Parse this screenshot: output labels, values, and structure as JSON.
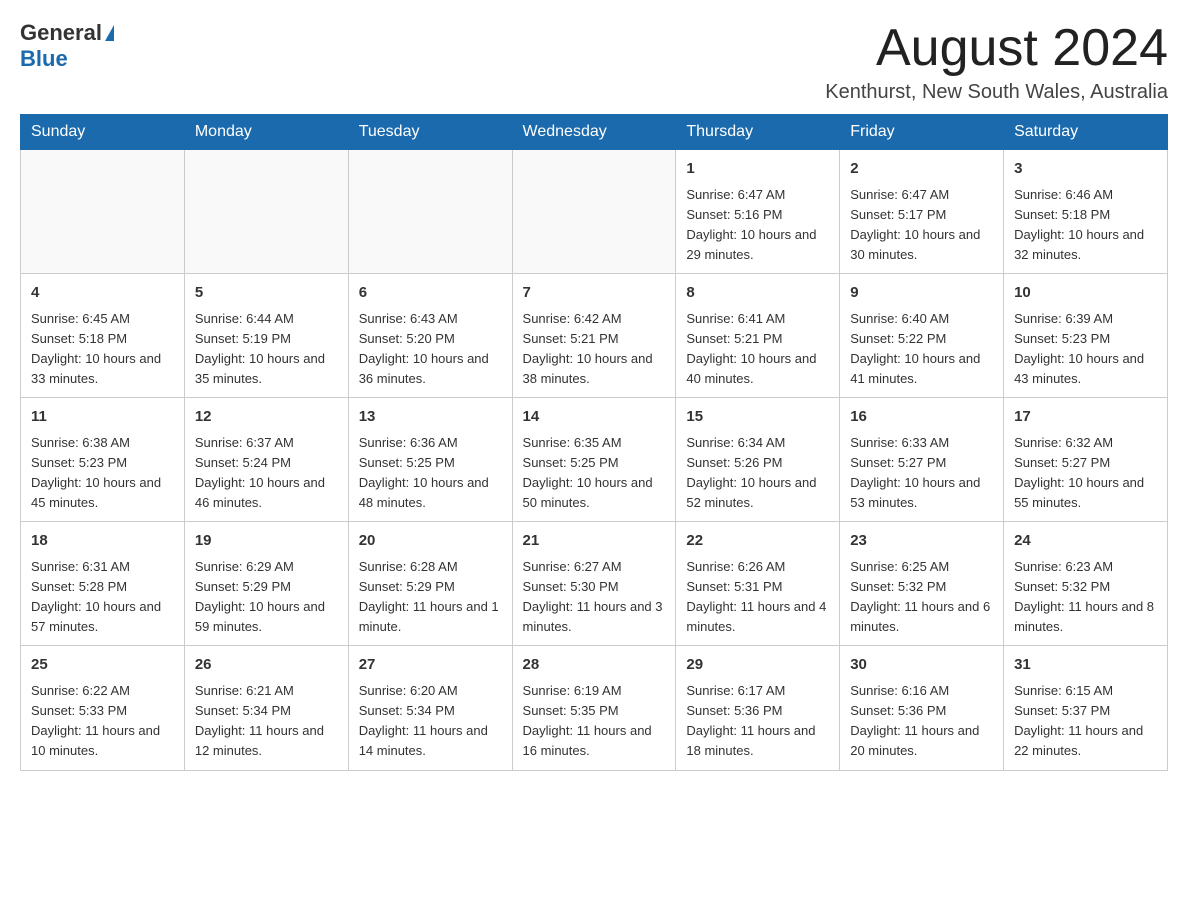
{
  "header": {
    "logo_general": "General",
    "logo_blue": "Blue",
    "month_title": "August 2024",
    "location": "Kenthurst, New South Wales, Australia"
  },
  "days_of_week": [
    "Sunday",
    "Monday",
    "Tuesday",
    "Wednesday",
    "Thursday",
    "Friday",
    "Saturday"
  ],
  "weeks": [
    [
      {
        "day": "",
        "info": ""
      },
      {
        "day": "",
        "info": ""
      },
      {
        "day": "",
        "info": ""
      },
      {
        "day": "",
        "info": ""
      },
      {
        "day": "1",
        "info": "Sunrise: 6:47 AM\nSunset: 5:16 PM\nDaylight: 10 hours and 29 minutes."
      },
      {
        "day": "2",
        "info": "Sunrise: 6:47 AM\nSunset: 5:17 PM\nDaylight: 10 hours and 30 minutes."
      },
      {
        "day": "3",
        "info": "Sunrise: 6:46 AM\nSunset: 5:18 PM\nDaylight: 10 hours and 32 minutes."
      }
    ],
    [
      {
        "day": "4",
        "info": "Sunrise: 6:45 AM\nSunset: 5:18 PM\nDaylight: 10 hours and 33 minutes."
      },
      {
        "day": "5",
        "info": "Sunrise: 6:44 AM\nSunset: 5:19 PM\nDaylight: 10 hours and 35 minutes."
      },
      {
        "day": "6",
        "info": "Sunrise: 6:43 AM\nSunset: 5:20 PM\nDaylight: 10 hours and 36 minutes."
      },
      {
        "day": "7",
        "info": "Sunrise: 6:42 AM\nSunset: 5:21 PM\nDaylight: 10 hours and 38 minutes."
      },
      {
        "day": "8",
        "info": "Sunrise: 6:41 AM\nSunset: 5:21 PM\nDaylight: 10 hours and 40 minutes."
      },
      {
        "day": "9",
        "info": "Sunrise: 6:40 AM\nSunset: 5:22 PM\nDaylight: 10 hours and 41 minutes."
      },
      {
        "day": "10",
        "info": "Sunrise: 6:39 AM\nSunset: 5:23 PM\nDaylight: 10 hours and 43 minutes."
      }
    ],
    [
      {
        "day": "11",
        "info": "Sunrise: 6:38 AM\nSunset: 5:23 PM\nDaylight: 10 hours and 45 minutes."
      },
      {
        "day": "12",
        "info": "Sunrise: 6:37 AM\nSunset: 5:24 PM\nDaylight: 10 hours and 46 minutes."
      },
      {
        "day": "13",
        "info": "Sunrise: 6:36 AM\nSunset: 5:25 PM\nDaylight: 10 hours and 48 minutes."
      },
      {
        "day": "14",
        "info": "Sunrise: 6:35 AM\nSunset: 5:25 PM\nDaylight: 10 hours and 50 minutes."
      },
      {
        "day": "15",
        "info": "Sunrise: 6:34 AM\nSunset: 5:26 PM\nDaylight: 10 hours and 52 minutes."
      },
      {
        "day": "16",
        "info": "Sunrise: 6:33 AM\nSunset: 5:27 PM\nDaylight: 10 hours and 53 minutes."
      },
      {
        "day": "17",
        "info": "Sunrise: 6:32 AM\nSunset: 5:27 PM\nDaylight: 10 hours and 55 minutes."
      }
    ],
    [
      {
        "day": "18",
        "info": "Sunrise: 6:31 AM\nSunset: 5:28 PM\nDaylight: 10 hours and 57 minutes."
      },
      {
        "day": "19",
        "info": "Sunrise: 6:29 AM\nSunset: 5:29 PM\nDaylight: 10 hours and 59 minutes."
      },
      {
        "day": "20",
        "info": "Sunrise: 6:28 AM\nSunset: 5:29 PM\nDaylight: 11 hours and 1 minute."
      },
      {
        "day": "21",
        "info": "Sunrise: 6:27 AM\nSunset: 5:30 PM\nDaylight: 11 hours and 3 minutes."
      },
      {
        "day": "22",
        "info": "Sunrise: 6:26 AM\nSunset: 5:31 PM\nDaylight: 11 hours and 4 minutes."
      },
      {
        "day": "23",
        "info": "Sunrise: 6:25 AM\nSunset: 5:32 PM\nDaylight: 11 hours and 6 minutes."
      },
      {
        "day": "24",
        "info": "Sunrise: 6:23 AM\nSunset: 5:32 PM\nDaylight: 11 hours and 8 minutes."
      }
    ],
    [
      {
        "day": "25",
        "info": "Sunrise: 6:22 AM\nSunset: 5:33 PM\nDaylight: 11 hours and 10 minutes."
      },
      {
        "day": "26",
        "info": "Sunrise: 6:21 AM\nSunset: 5:34 PM\nDaylight: 11 hours and 12 minutes."
      },
      {
        "day": "27",
        "info": "Sunrise: 6:20 AM\nSunset: 5:34 PM\nDaylight: 11 hours and 14 minutes."
      },
      {
        "day": "28",
        "info": "Sunrise: 6:19 AM\nSunset: 5:35 PM\nDaylight: 11 hours and 16 minutes."
      },
      {
        "day": "29",
        "info": "Sunrise: 6:17 AM\nSunset: 5:36 PM\nDaylight: 11 hours and 18 minutes."
      },
      {
        "day": "30",
        "info": "Sunrise: 6:16 AM\nSunset: 5:36 PM\nDaylight: 11 hours and 20 minutes."
      },
      {
        "day": "31",
        "info": "Sunrise: 6:15 AM\nSunset: 5:37 PM\nDaylight: 11 hours and 22 minutes."
      }
    ]
  ]
}
